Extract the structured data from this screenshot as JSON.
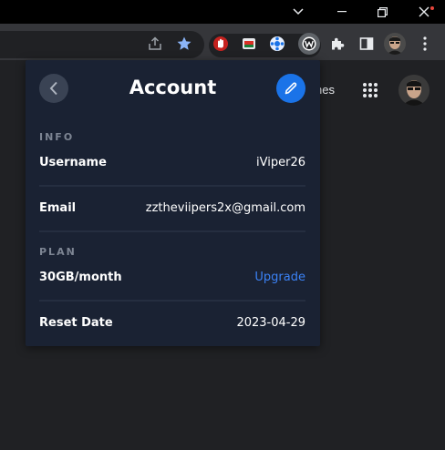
{
  "window": {
    "buttons": [
      "chevron-down",
      "minimize",
      "maximize",
      "close"
    ],
    "close_badge_color": "#e8453c"
  },
  "toolbar": {
    "icons": [
      "share-icon",
      "bookmark-star-icon",
      "ublock-icon",
      "gallery-extension-icon",
      "tiling-extension-icon",
      "wordtune-extension-icon",
      "extensions-puzzle-icon",
      "side-panel-icon",
      "profile-avatar",
      "menu-kebab-icon"
    ],
    "star_color": "#8ab4f8"
  },
  "page": {
    "partial_text": "nes"
  },
  "popup": {
    "title": "Account",
    "info_label": "INFO",
    "username_label": "Username",
    "username_value": "iViper26",
    "email_label": "Email",
    "email_value": "zztheviipers2x@gmail.com",
    "plan_label": "PLAN",
    "plan_name": "30GB/month",
    "upgrade_label": "Upgrade",
    "reset_label": "Reset Date",
    "reset_value": "2023-04-29",
    "accent_color": "#1a73e8",
    "link_color": "#3b82f6",
    "background_color": "#1a2233"
  }
}
